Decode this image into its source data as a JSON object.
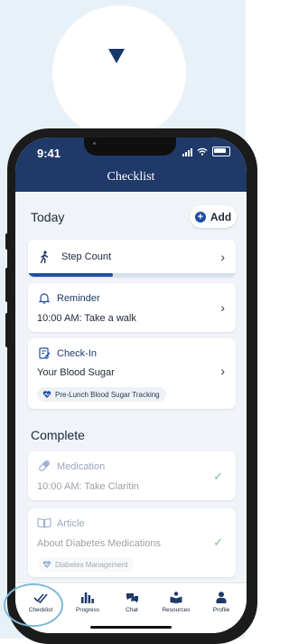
{
  "status_bar": {
    "time": "9:41"
  },
  "header": {
    "title": "Checklist"
  },
  "today": {
    "heading": "Today",
    "add_label": "Add"
  },
  "cards": {
    "step": {
      "title": "Step Count",
      "progress": 0.41
    },
    "reminder": {
      "title": "Reminder",
      "text": "10:00 AM: Take a walk"
    },
    "checkin": {
      "title": "Check-In",
      "text": "Your Blood Sugar",
      "tag": "Pre-Lunch Blood Sugar Tracking"
    }
  },
  "complete": {
    "heading": "Complete",
    "medication": {
      "title": "Medication",
      "text": "10:00 AM: Take Claritin"
    },
    "article": {
      "title": "Article",
      "text": "About Diabetes Medications",
      "tag": "Diabetes Management"
    }
  },
  "tabs": [
    {
      "label": "Checklist",
      "icon": "checklist-icon"
    },
    {
      "label": "Progress",
      "icon": "bar-chart-icon"
    },
    {
      "label": "Chat",
      "icon": "chat-icon"
    },
    {
      "label": "Resources",
      "icon": "resources-icon"
    },
    {
      "label": "Profile",
      "icon": "profile-icon"
    }
  ],
  "colors": {
    "navy": "#1f3a69",
    "accent": "#1f4ea3",
    "check_green": "#7cc48c",
    "background": "#e9f1f8"
  }
}
